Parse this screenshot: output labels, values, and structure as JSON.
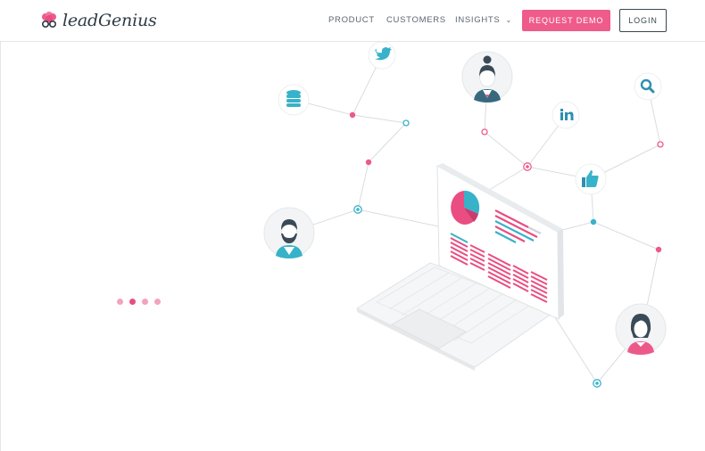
{
  "brand": {
    "name": "leadGenius",
    "accent": "#ef5b8b",
    "dark": "#2d3a45",
    "teal": "#38b2c9"
  },
  "nav": {
    "product": "PRODUCT",
    "customers": "CUSTOMERS",
    "insights": "INSIGHTS",
    "request_demo": "REQUEST DEMO",
    "login": "LOGIN"
  },
  "carousel": {
    "slides": 4,
    "active_index": 1
  },
  "hero_icons": [
    "twitter-icon",
    "database-icon",
    "linkedin-icon",
    "search-icon",
    "thumbs-up-icon",
    "woman-avatar",
    "man-avatar",
    "woman-avatar-2",
    "laptop-illustration"
  ]
}
